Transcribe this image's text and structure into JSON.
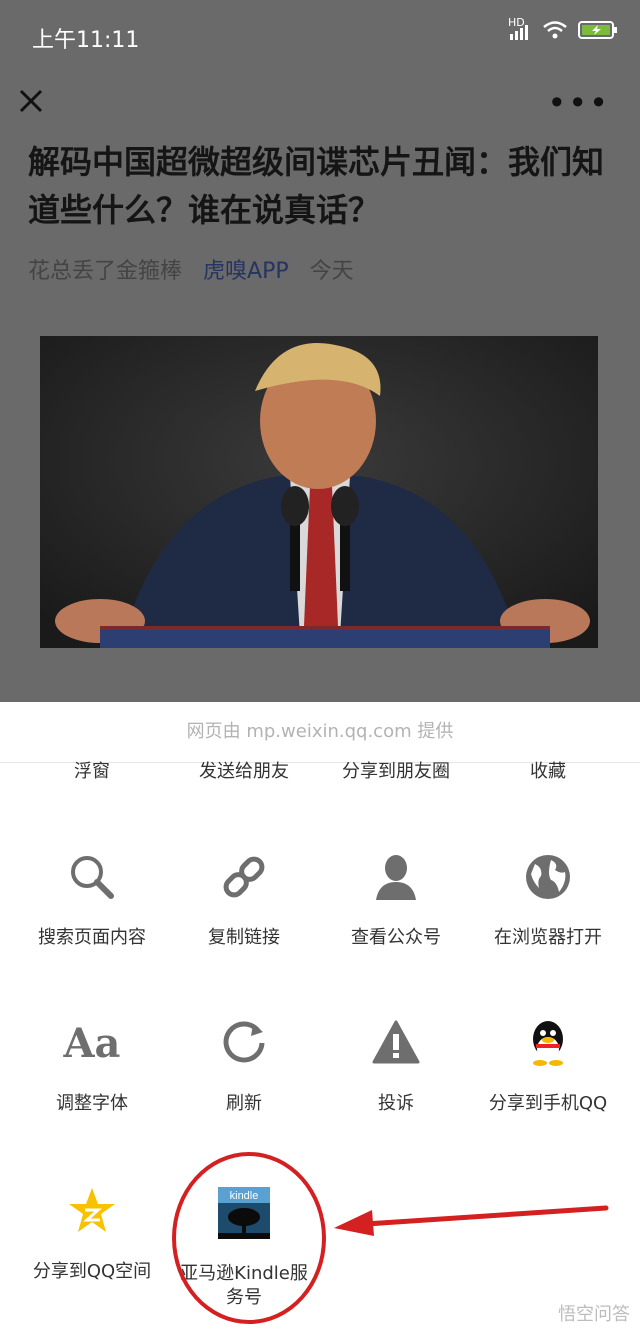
{
  "status_bar": {
    "time": "上午11:11",
    "network": "HD"
  },
  "article": {
    "title": "解码中国超微超级间谍芯片丑闻：我们知道些什么？谁在说真话？",
    "author": "花总丢了金箍棒",
    "account": "虎嗅APP",
    "date": "今天"
  },
  "sheet": {
    "provider": "网页由 mp.weixin.qq.com 提供",
    "row0": [
      "浮窗",
      "发送给朋友",
      "分享到朋友圈",
      "收藏"
    ],
    "row1": [
      {
        "label": "搜索页面内容",
        "icon": "search-icon"
      },
      {
        "label": "复制链接",
        "icon": "link-icon"
      },
      {
        "label": "查看公众号",
        "icon": "person-icon"
      },
      {
        "label": "在浏览器打开",
        "icon": "globe-icon"
      }
    ],
    "row2": [
      {
        "label": "调整字体",
        "icon": "font-icon",
        "glyph": "Aa"
      },
      {
        "label": "刷新",
        "icon": "refresh-icon"
      },
      {
        "label": "投诉",
        "icon": "warning-icon"
      },
      {
        "label": "分享到手机QQ",
        "icon": "qq-penguin-icon"
      }
    ],
    "row3": [
      {
        "label": "分享到QQ空间",
        "icon": "qzone-star-icon"
      },
      {
        "label": "亚马逊Kindle服务号",
        "icon": "kindle-icon",
        "icon_text": "kindle"
      }
    ]
  },
  "watermark": "悟空问答",
  "colors": {
    "annotation_red": "#d42020",
    "dim_overlay": "#6a6a6a"
  }
}
